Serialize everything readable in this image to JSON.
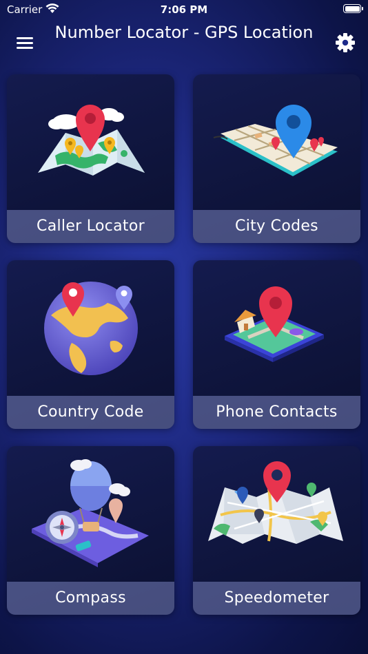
{
  "status_bar": {
    "carrier": "Carrier",
    "time": "7:06 PM",
    "wifi_icon": "wifi-icon",
    "battery_icon": "battery-icon"
  },
  "header": {
    "title": "Number Locator - GPS Location",
    "menu_icon": "hamburger-menu-icon",
    "settings_icon": "gear-icon"
  },
  "cards": [
    {
      "label": "Caller Locator",
      "icon": "map-pin-illustration"
    },
    {
      "label": "City Codes",
      "icon": "city-map-illustration"
    },
    {
      "label": "Country Code",
      "icon": "globe-illustration"
    },
    {
      "label": "Phone Contacts",
      "icon": "location-house-illustration"
    },
    {
      "label": "Compass",
      "icon": "compass-balloon-illustration"
    },
    {
      "label": "Speedometer",
      "icon": "folded-map-illustration"
    }
  ],
  "colors": {
    "background": "#1a2475",
    "card": "#111848",
    "label_bar": "#6f78b8",
    "pin_red": "#e8344e",
    "pin_blue": "#2b8ae8"
  }
}
